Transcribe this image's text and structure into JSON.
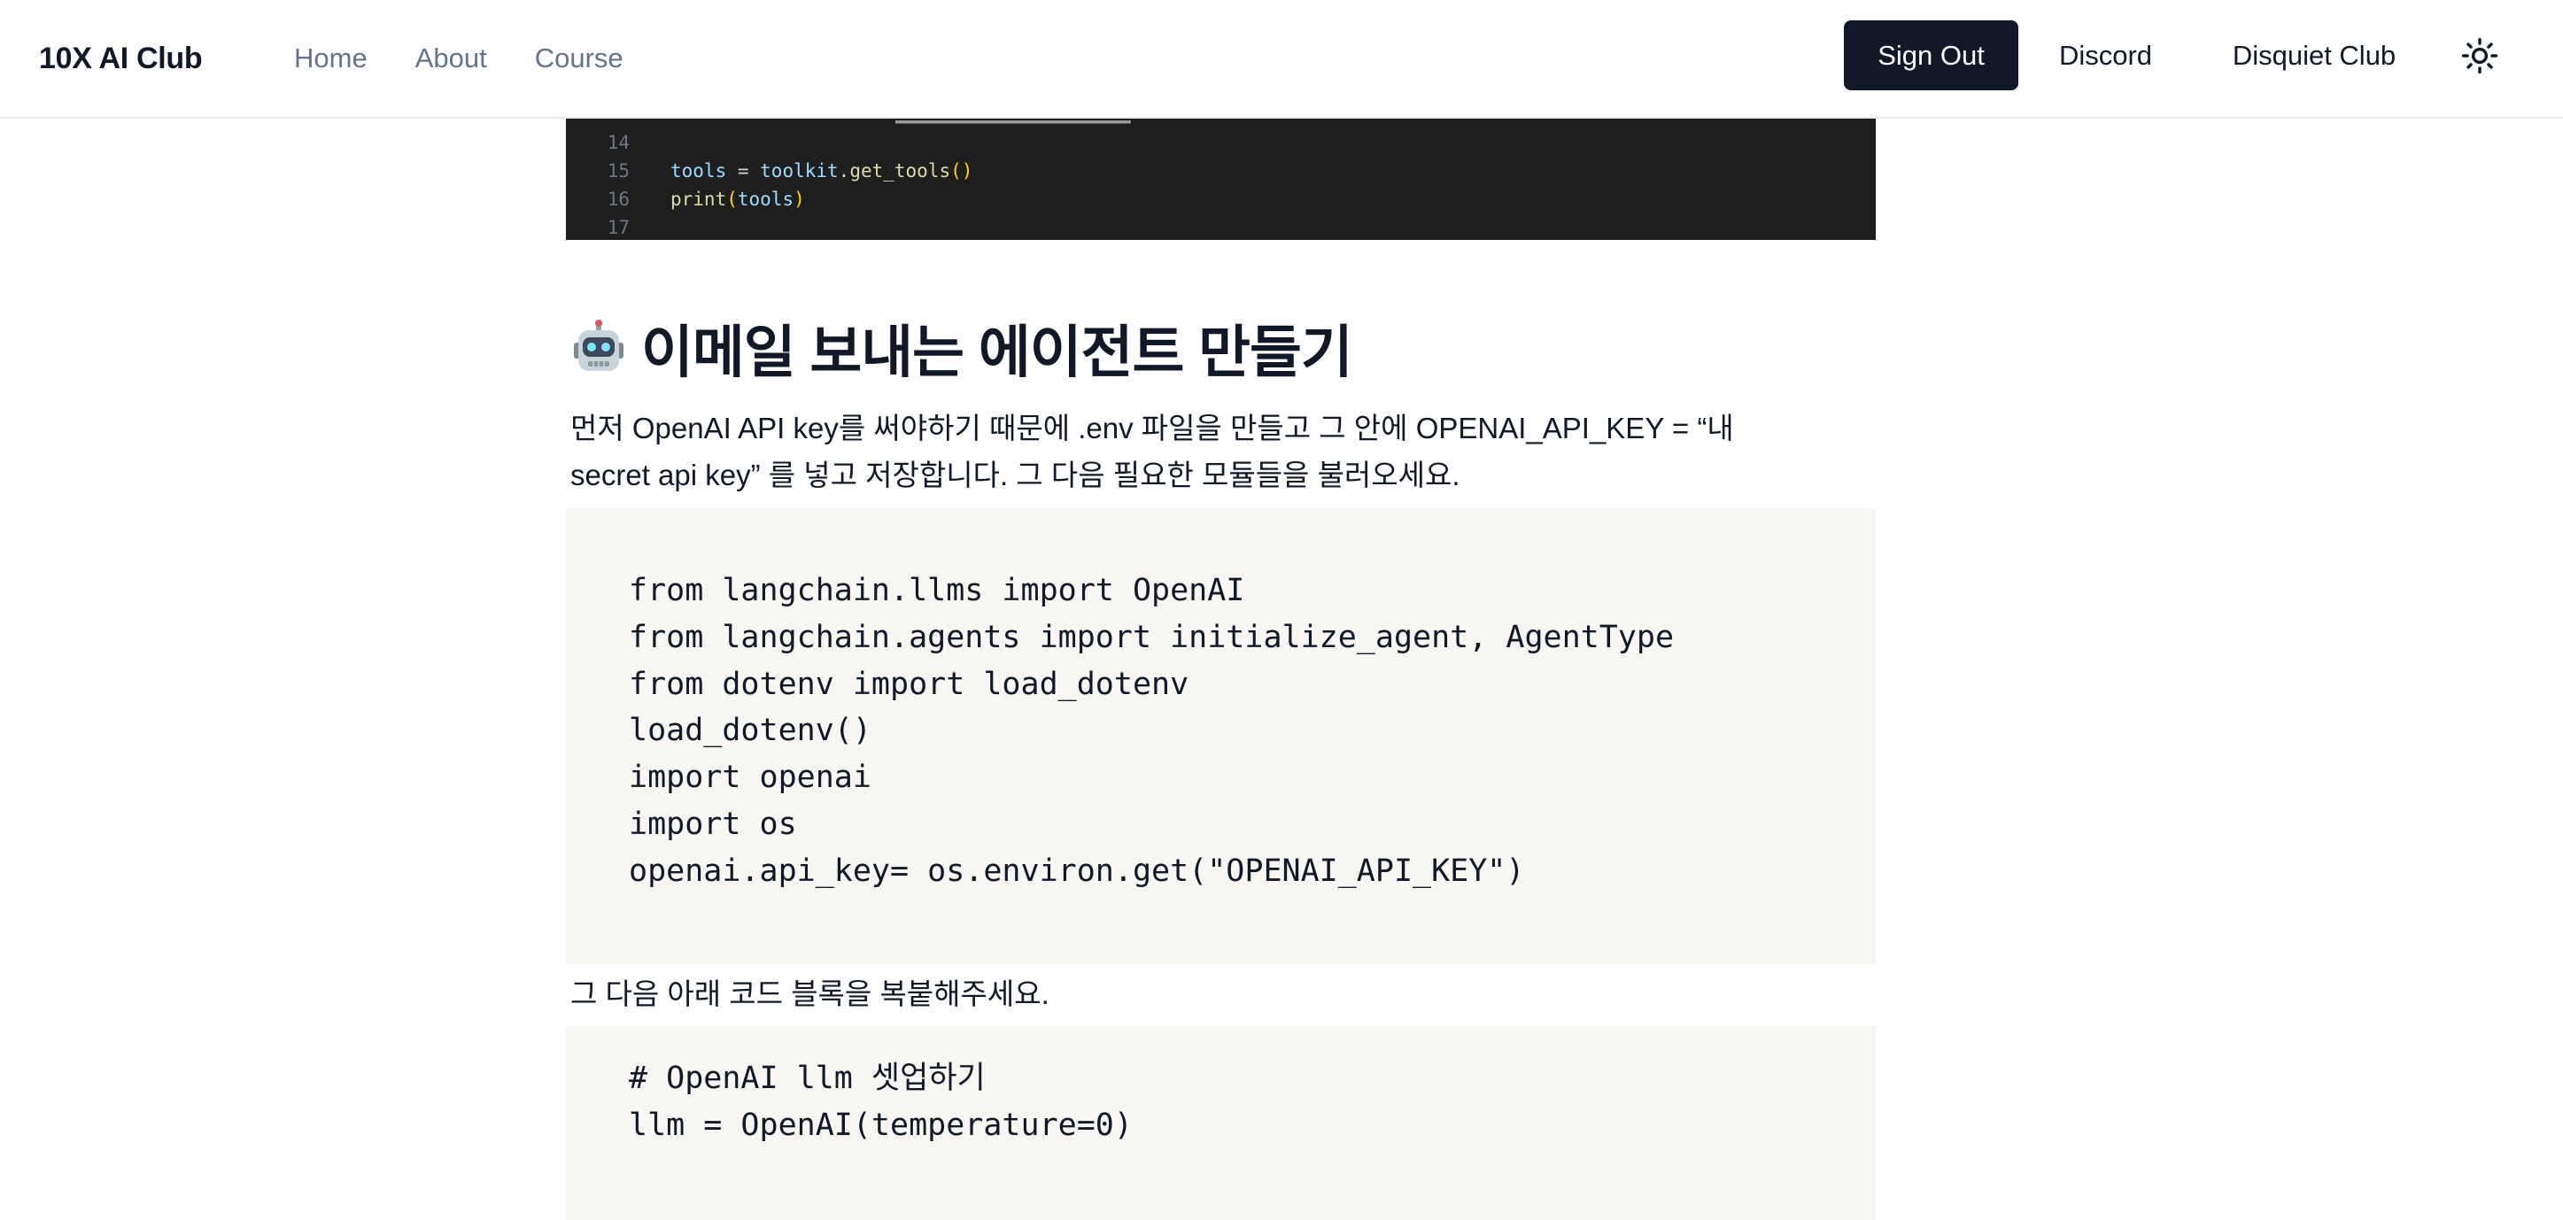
{
  "header": {
    "brand": "10X AI Club",
    "nav": [
      "Home",
      "About",
      "Course"
    ],
    "sign_out": "Sign Out",
    "discord": "Discord",
    "disquiet": "Disquiet Club",
    "theme_icon": "sun-icon"
  },
  "dark_code": {
    "lines": [
      {
        "num": "14",
        "tokens": []
      },
      {
        "num": "15",
        "tokens": [
          {
            "t": "tools",
            "c": "var"
          },
          {
            "t": " = ",
            "c": "plain"
          },
          {
            "t": "toolkit",
            "c": "var"
          },
          {
            "t": ".",
            "c": "plain"
          },
          {
            "t": "get_tools",
            "c": "fn"
          },
          {
            "t": "()",
            "c": "paren"
          }
        ]
      },
      {
        "num": "16",
        "tokens": [
          {
            "t": "print",
            "c": "fn"
          },
          {
            "t": "(",
            "c": "paren"
          },
          {
            "t": "tools",
            "c": "var"
          },
          {
            "t": ")",
            "c": "paren"
          }
        ]
      },
      {
        "num": "17",
        "tokens": []
      }
    ]
  },
  "section": {
    "emoji_icon": "robot-icon",
    "title": "이메일 보내는 에이전트 만들기",
    "intro_line1": "먼저 OpenAI API key를 써야하기 때문에 .env 파일을 만들고 그 안에 OPENAI_API_KEY = “내",
    "intro_line2": "secret api key” 를 넣고 저장합니다. 그 다음 필요한 모듈들을 불러오세요.",
    "code1": [
      "from langchain.llms import OpenAI",
      "from langchain.agents import initialize_agent, AgentType",
      "from dotenv import load_dotenv",
      "load_dotenv()",
      "import openai",
      "import os",
      "openai.api_key= os.environ.get(\"OPENAI_API_KEY\")"
    ],
    "copy_instruction": "그 다음 아래 코드 블록을 복붙해주세요.",
    "code2": [
      "# OpenAI llm 셋업하기",
      "llm = OpenAI(temperature=0)"
    ]
  },
  "colors": {
    "dark_code_bg": "#1e1e1e",
    "code_block_bg": "#f7f6f3",
    "primary_button": "#111827"
  }
}
